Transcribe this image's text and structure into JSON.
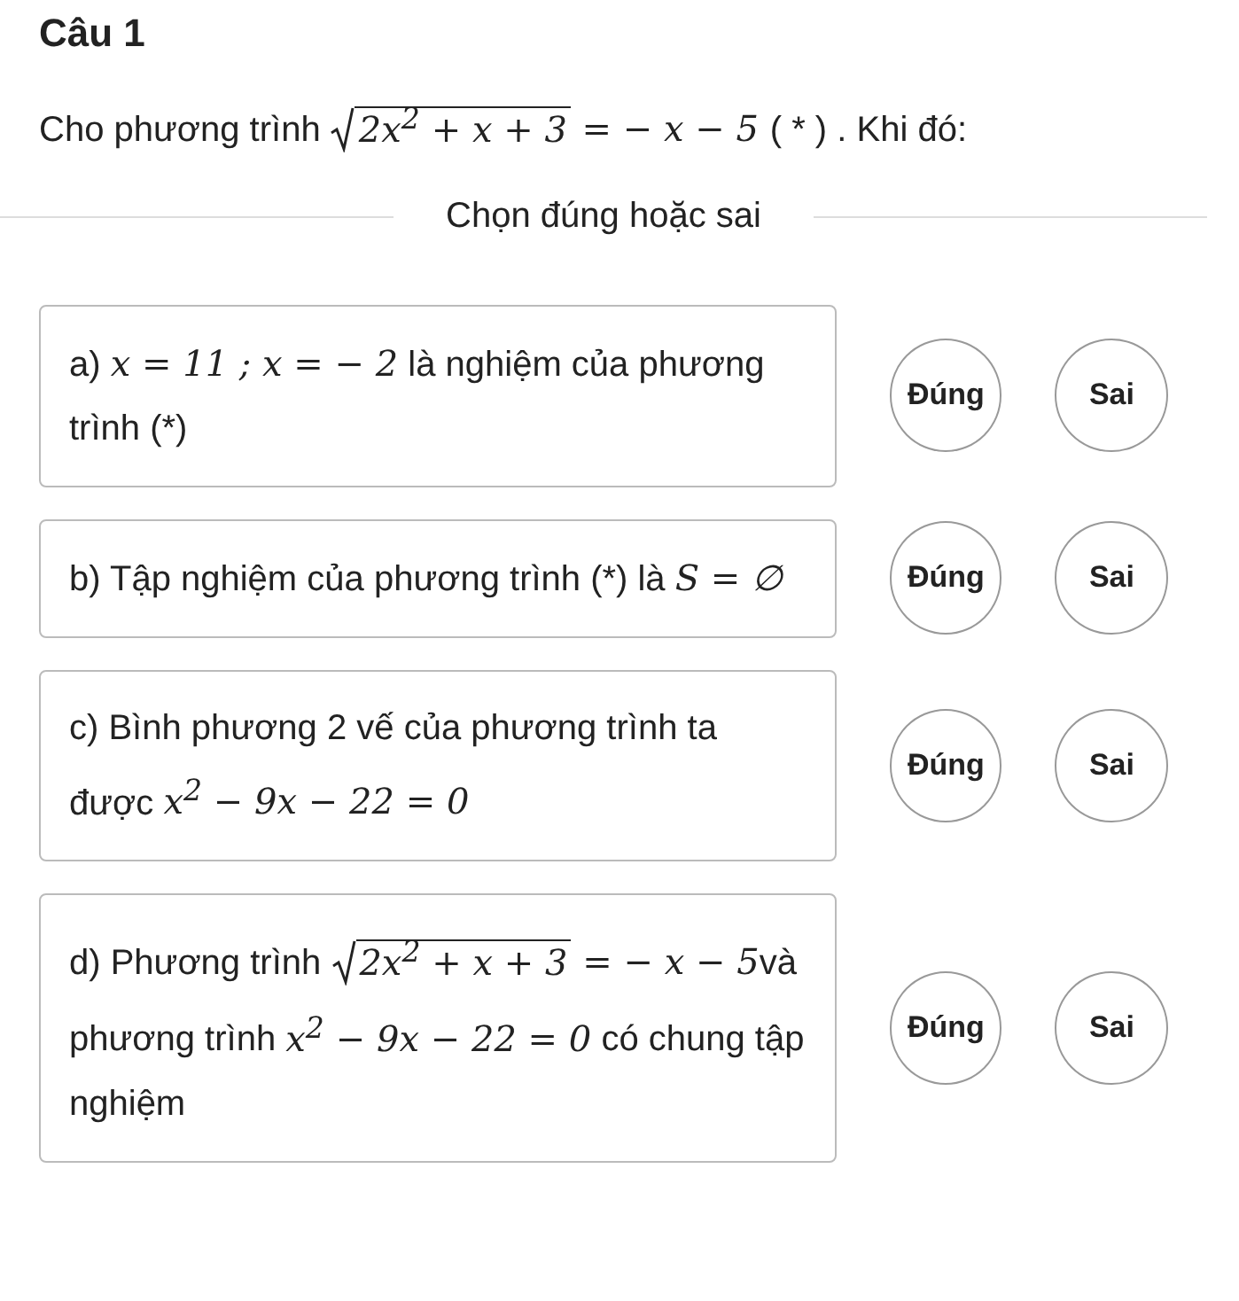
{
  "title": "Câu 1",
  "question": [
    {
      "kind": "text",
      "text": "Cho phương trình "
    },
    {
      "kind": "sqrt",
      "text": "2x$^{2}$ + x + 3"
    },
    {
      "kind": "math",
      "text": " = − x − 5 "
    },
    {
      "kind": "text",
      "text": " ( * ) . Khi đó:"
    }
  ],
  "instruction": "Chọn đúng hoặc sai",
  "items": [
    {
      "parts": [
        {
          "kind": "text",
          "text": "a) "
        },
        {
          "kind": "math",
          "text": "x = 11 ; x = − 2"
        },
        {
          "kind": "text",
          "text": " là nghiệm của phương trình (*)"
        }
      ],
      "options": [
        {
          "label": "Đúng",
          "selected": false
        },
        {
          "label": "Sai",
          "selected": false
        }
      ]
    },
    {
      "parts": [
        {
          "kind": "text",
          "text": "b) Tập nghiệm của phương trình (*) là "
        },
        {
          "kind": "math",
          "text": "S = ∅"
        }
      ],
      "options": [
        {
          "label": "Đúng",
          "selected": false
        },
        {
          "label": "Sai",
          "selected": false
        }
      ]
    },
    {
      "parts": [
        {
          "kind": "text",
          "text": "c) Bình phương 2 vế của phương trình ta được "
        },
        {
          "kind": "math",
          "text": "x$^{2}$ − 9x − 22 = 0"
        }
      ],
      "options": [
        {
          "label": "Đúng",
          "selected": false
        },
        {
          "label": "Sai",
          "selected": false
        }
      ]
    },
    {
      "parts": [
        {
          "kind": "text",
          "text": "d) Phương trình "
        },
        {
          "kind": "sqrt",
          "text": "2x$^{2}$ + x + 3"
        },
        {
          "kind": "math",
          "text": " = − x − 5"
        },
        {
          "kind": "text",
          "text": "và phương trình "
        },
        {
          "kind": "math",
          "text": "x$^{2}$ − 9x − 22 = 0"
        },
        {
          "kind": "text",
          "text": " có chung tập nghiệm"
        }
      ],
      "options": [
        {
          "label": "Đúng",
          "selected": false
        },
        {
          "label": "Sai",
          "selected": false
        }
      ]
    }
  ]
}
